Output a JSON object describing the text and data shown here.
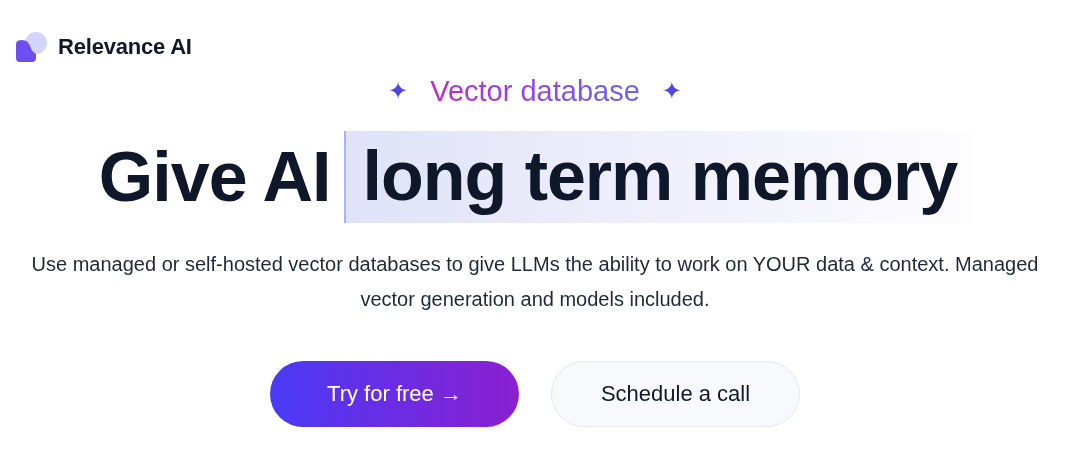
{
  "brand": {
    "name": "Relevance AI"
  },
  "eyebrow": {
    "sparkle_left": "✦",
    "label": "Vector database",
    "sparkle_right": "✦"
  },
  "headline": {
    "lead": "Give AI",
    "highlight": "long term memory"
  },
  "description": "Use managed or self-hosted vector databases to give LLMs the ability to work on YOUR data & context. Managed vector generation and models included.",
  "buttons": [
    {
      "kind": "primary",
      "label": "Try for free →"
    },
    {
      "kind": "secondary",
      "label": "Schedule a call"
    }
  ]
}
